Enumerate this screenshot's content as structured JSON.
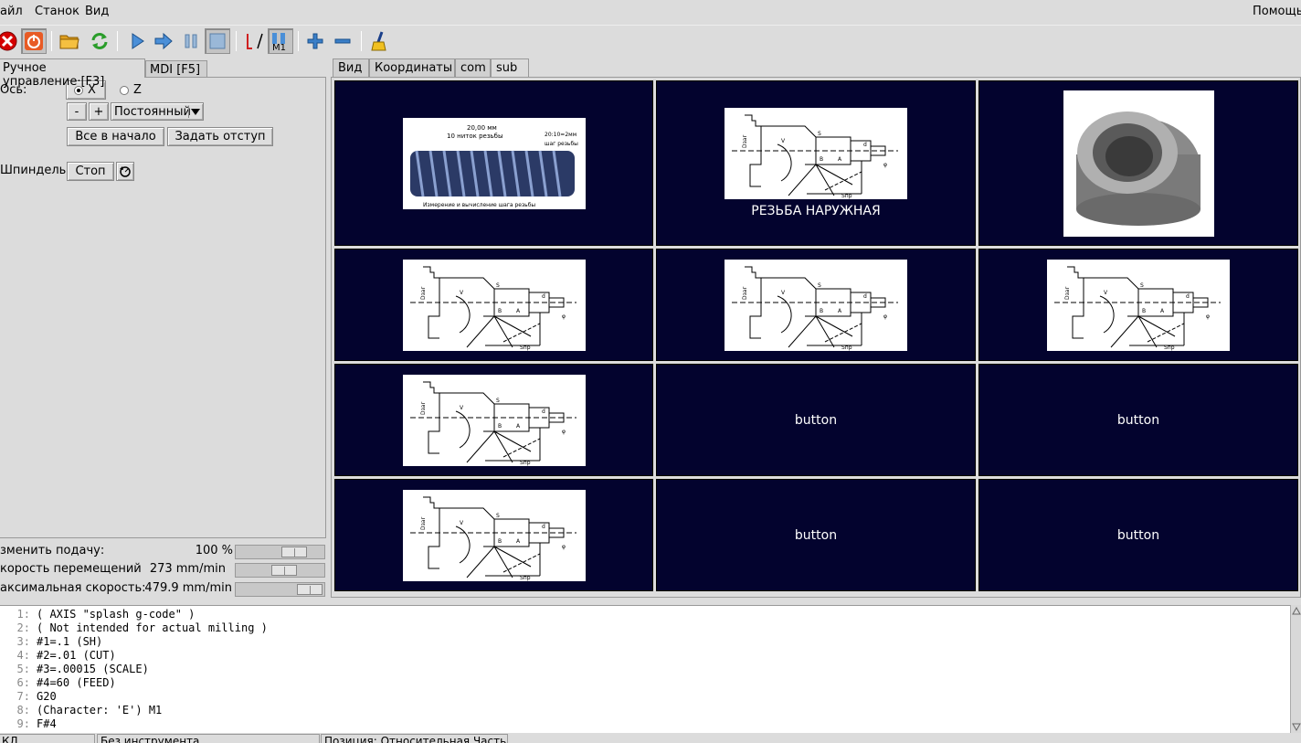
{
  "menu": {
    "file": "айл",
    "machine": "Станок",
    "view": "Вид",
    "help": "Помощь"
  },
  "toolbar": {
    "m1_label": "M1"
  },
  "left_tabs": {
    "manual": "Ручное управление·[F3]",
    "mdi": "MDI [F5]"
  },
  "manual": {
    "axis_label": "Ось:",
    "axis_x": "X",
    "axis_z": "Z",
    "minus": "-",
    "plus": "+",
    "jog_mode": "Постоянный",
    "home_all": "Все в начало",
    "touch_off": "Задать отступ",
    "spindle_label": "Шпиндель:",
    "spindle_stop": "Стоп"
  },
  "overrides": [
    {
      "label": "зменить подачу:",
      "value": "100 %",
      "level": 0.75
    },
    {
      "label": "корость перемещений",
      "value": "273 mm/min",
      "level": 0.58
    },
    {
      "label": "аксимальная скорость:",
      "value": "479.9 mm/min",
      "level": 1.0
    }
  ],
  "right_tabs": [
    "Вид",
    "Координаты",
    "com",
    "sub"
  ],
  "grid": {
    "caption_thread_external": "РЕЗЬБА НАРУЖНАЯ",
    "button_1": "button",
    "button_2": "button",
    "button_3": "button",
    "button_4": "button",
    "thread_title": "20,00 мм",
    "thread_turns": "10 ниток резьбы",
    "thread_pitch": "20:10=2мм",
    "thread_pitch_label": "шаг резьбы",
    "thread_caption": "Измерение и вычисление шага резьбы"
  },
  "gcode": [
    {
      "n": "1:",
      "text": "( AXIS \"splash g-code\" )"
    },
    {
      "n": "2:",
      "text": "( Not intended for actual milling )"
    },
    {
      "n": "3:",
      "text": "#1=.1 (SH)"
    },
    {
      "n": "4:",
      "text": "#2=.01 (CUT)"
    },
    {
      "n": "5:",
      "text": "#3=.00015 (SCALE)"
    },
    {
      "n": "6:",
      "text": "#4=60 (FEED)"
    },
    {
      "n": "7:",
      "text": "G20"
    },
    {
      "n": "8:",
      "text": "(Character: 'E') M1"
    },
    {
      "n": "9:",
      "text": "F#4"
    }
  ],
  "status": {
    "state": "КЛ",
    "tool": "Без инструмента",
    "position": "Позиция: Относительная Часть"
  }
}
